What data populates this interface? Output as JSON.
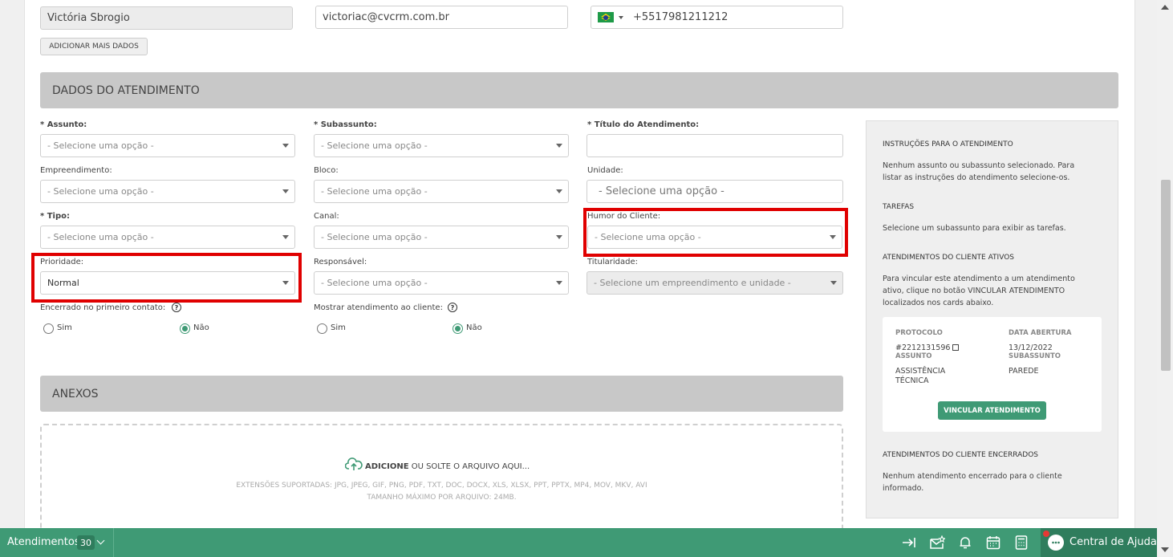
{
  "contact": {
    "name": "Victória Sbrogio",
    "email": "victoriac@cvcrm.com.br",
    "phone": "+5517981211212",
    "add_more_label": "ADICIONAR MAIS DADOS"
  },
  "sections": {
    "dados": "DADOS DO ATENDIMENTO",
    "anexos": "ANEXOS"
  },
  "fields": {
    "assunto": {
      "label": "Assunto:",
      "value": "- Selecione uma opção -"
    },
    "subassunto": {
      "label": "Subassunto:",
      "value": "- Selecione uma opção -"
    },
    "titulo": {
      "label": "Título do Atendimento:",
      "value": ""
    },
    "empreendimento": {
      "label": "Empreendimento:",
      "value": "- Selecione uma opção -"
    },
    "bloco": {
      "label": "Bloco:",
      "value": "- Selecione uma opção -"
    },
    "unidade": {
      "label": "Unidade:",
      "value": "- Selecione uma opção -"
    },
    "tipo": {
      "label": "Tipo:",
      "value": "- Selecione uma opção -"
    },
    "canal": {
      "label": "Canal:",
      "value": "- Selecione uma opção -"
    },
    "humor": {
      "label": "Humor do Cliente:",
      "value": "- Selecione uma opção -"
    },
    "prioridade": {
      "label": "Prioridade:",
      "value": "Normal"
    },
    "responsavel": {
      "label": "Responsável:",
      "value": "- Selecione uma opção -"
    },
    "titularidade": {
      "label": "Titularidade:",
      "value": "- Selecione um empreendimento e unidade -"
    }
  },
  "required_mark": "*",
  "radios": {
    "encerrado": {
      "label": "Encerrado no primeiro contato:",
      "yes": "Sim",
      "no": "Não",
      "selected": "no"
    },
    "mostrar": {
      "label": "Mostrar atendimento ao cliente:",
      "yes": "Sim",
      "no": "Não",
      "selected": "no"
    },
    "help": "?"
  },
  "upload": {
    "add": "ADICIONE",
    "rest": " OU SOLTE O ARQUIVO AQUI...",
    "extensions": "EXTENSÕES SUPORTADAS: JPG, JPEG, GIF, PNG, PDF, TXT, DOC, DOCX, XLS, XLSX, PPT, PPTX, MP4, MOV, MKV, AVI",
    "max_size": "TAMANHO MÁXIMO POR ARQUIVO: 24MB."
  },
  "sidebar": {
    "instr_title": "INSTRUÇÕES PARA O ATENDIMENTO",
    "instr_text_1": "Nenhum assunto ou subassunto selecionado. Para",
    "instr_text_2": "listar as instruções do atendimento selecione-os.",
    "tarefas_title": "TAREFAS",
    "tarefas_text": "Selecione um subassunto para exibir as tarefas.",
    "ativos_title": "ATENDIMENTOS DO CLIENTE ATIVOS",
    "ativos_text_1": "Para vincular este atendimento a um atendimento",
    "ativos_text_2": "ativo, clique no botão VINCULAR ATENDIMENTO",
    "ativos_text_3": "localizados nos cards abaixo.",
    "card": {
      "protocolo_label": "PROTOCOLO",
      "protocolo": "#2212131596",
      "abertura_label": "DATA ABERTURA",
      "abertura": "13/12/2022",
      "assunto_label": "ASSUNTO",
      "assunto_1": "ASSISTÊNCIA",
      "assunto_2": "TÉCNICA",
      "subassunto_label": "SUBASSUNTO",
      "subassunto": "PAREDE",
      "button": "VINCULAR ATENDIMENTO"
    },
    "encerrados_title": "ATENDIMENTOS DO CLIENTE ENCERRADOS",
    "encerrados_text_1": "Nenhum atendimento encerrado para o cliente",
    "encerrados_text_2": "informado."
  },
  "bottom_bar": {
    "atendimentos_label": "Atendimentos",
    "count": "30",
    "help_center": "Central de Ajuda"
  },
  "colors": {
    "accent": "#3f9a75",
    "highlight": "#e00000"
  }
}
